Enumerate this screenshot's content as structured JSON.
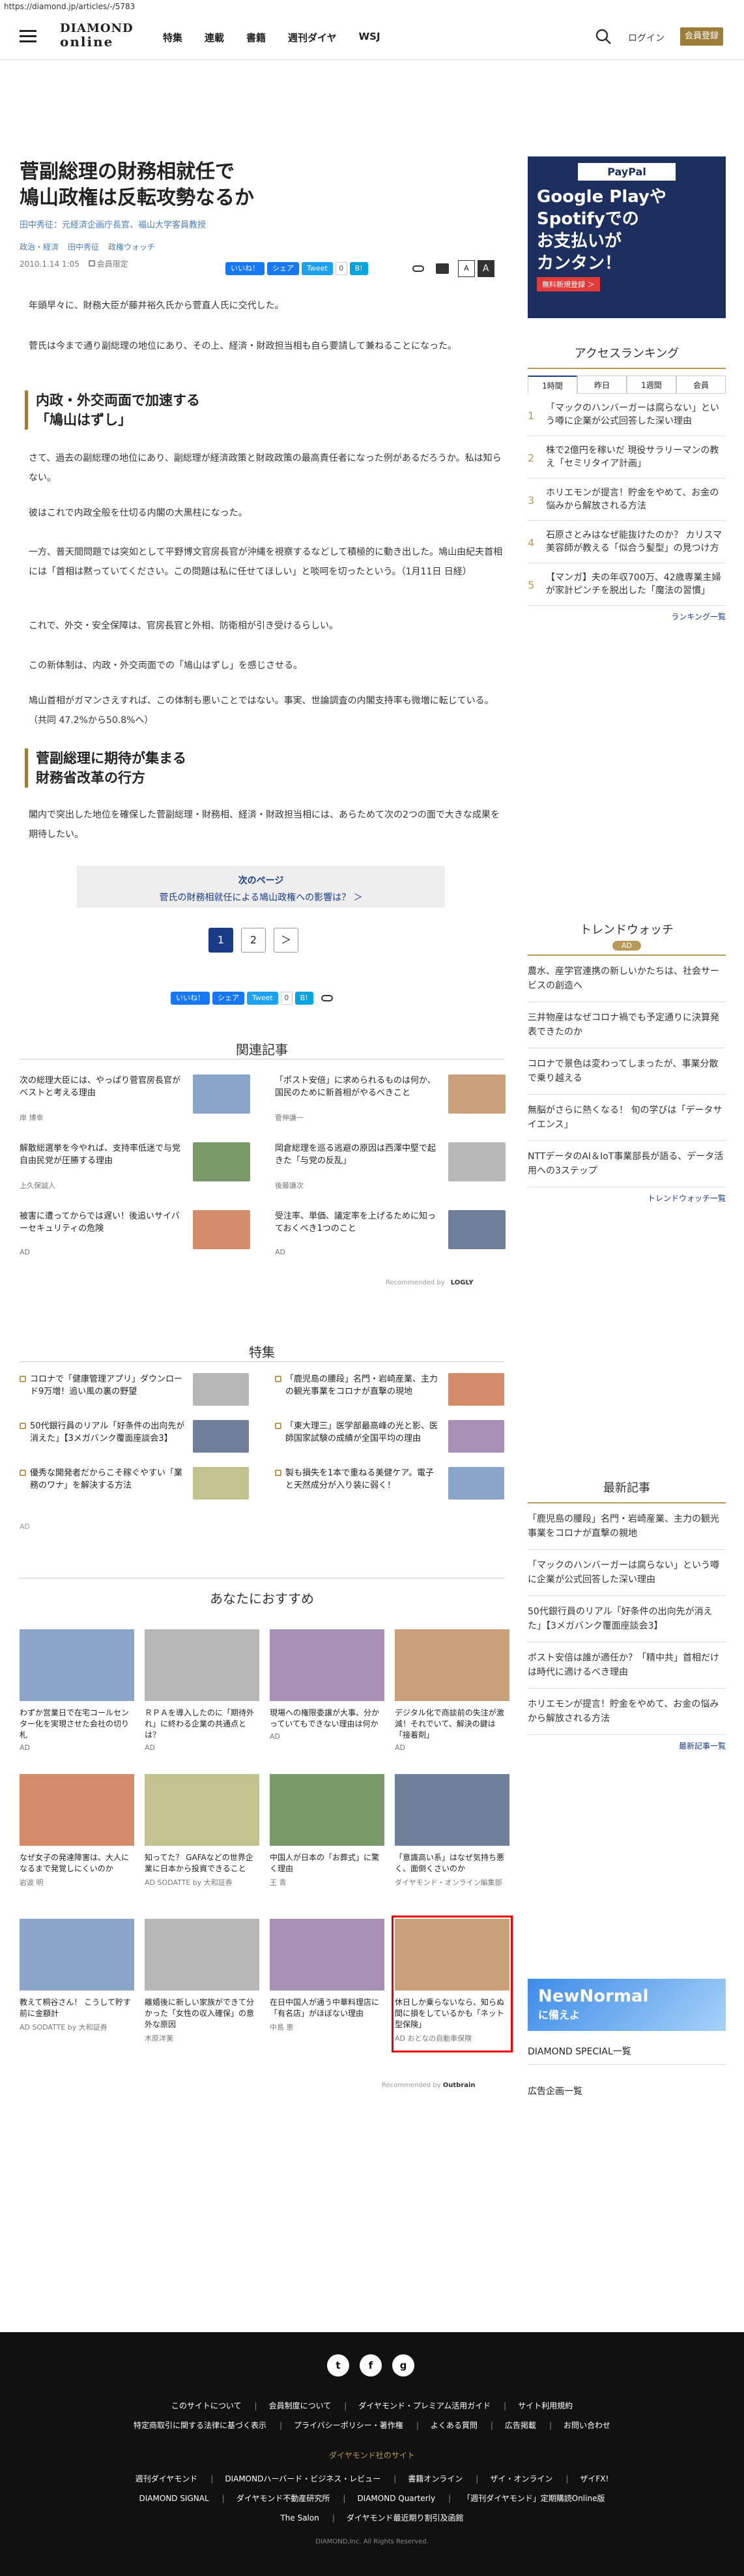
{
  "url": "https://diamond.jp/articles/-/5783",
  "header": {
    "logo_top": "DIAMOND",
    "logo_bottom": "online",
    "nav": [
      "特集",
      "連載",
      "書籍",
      "週刊ダイヤ",
      "WSJ"
    ],
    "login": "ログイン",
    "register": "会員登録"
  },
  "article": {
    "title_line1": "菅副総理の財務相就任で",
    "title_line2": "鳩山政権は反転攻勢なるか",
    "authors": "田中秀征：元経済企画庁長官、福山大学客員教授",
    "categories": [
      "政治・経済",
      "田中秀征",
      "政権ウォッチ"
    ],
    "date": "2010.1.14 1:05",
    "member": "会員限定",
    "share": {
      "like": "いいね！",
      "share": "シェア",
      "tweet": "Tweet",
      "tweet_count": "0",
      "hatena": "B!",
      "hatena_count": "0",
      "font_small": "A",
      "font_large": "A"
    },
    "paragraphs": [
      "年頭早々に、財務大臣が藤井裕久氏から菅直人氏に交代した。",
      "菅氏は今まで通り副総理の地位にあり、その上、経済・財政担当相も自ら要請して兼ねることになった。",
      "さて、過去の副総理の地位にあり、副総理が経済政策と財政政策の最高責任者になった例があるだろうか。私は知らない。",
      "彼はこれで内政全般を仕切る内閣の大黒柱になった。",
      "一方、普天間問題では突如として平野博文官房長官が沖縄を視察するなどして積極的に動き出した。鳩山由紀夫首相には「首相は黙っていてください。この問題は私に任せてほしい」と啖呵を切ったという。（1月11日 日経）",
      "これで、外交・安全保障は、官房長官と外相、防衛相が引き受けるらしい。",
      "この新体制は、内政・外交両面での「鳩山はずし」を感じさせる。",
      "鳩山首相がガマンさえすれば、この体制も悪いことではない。事実、世論調査の内閣支持率も微増に転じている。（共同 47.2%から50.8%へ）",
      "閣内で突出した地位を確保した菅副総理・財務相、経済・財政担当相には、あらためて次の2つの面で大きな成果を期待したい。"
    ],
    "heading1_line1": "内政・外交両面で加速する",
    "heading1_line2": "「鳩山はずし」",
    "heading2_line1": "菅副総理に期待が集まる",
    "heading2_line2": "財務省改革の行方",
    "next": {
      "label": "次のページ",
      "link": "菅氏の財務相就任による鳩山政権への影響は？ ＞"
    },
    "pages": [
      "1",
      "2",
      "＞"
    ]
  },
  "related": {
    "title": "関連記事",
    "recommended": "Recommended by",
    "rec_brand": "LOGLY",
    "items": [
      {
        "text": "次の総理大臣には、やっぱり菅官房長官がベストと考える理由",
        "sub": "岸 博幸"
      },
      {
        "text": "「ポスト安倍」に求められるものは何か、国民のために新首相がやるべきこと",
        "sub": "菅伸謙一"
      },
      {
        "text": "解散総選挙を今やれば、支持率低迷で与党自由民党が圧勝する理由",
        "sub": "上久保誠人"
      },
      {
        "text": "岡倉総理を巡る逃避の原因は西澤中堅で起きた「与党の反乱」",
        "sub": "後藤謙次"
      },
      {
        "text": "被害に遭ってからでは遅い！後追いサイバーセキュリティの危険",
        "sub": "AD"
      },
      {
        "text": "受注率、単価、議定率を上げるために知っておくべき1つのこと",
        "sub": "AD"
      }
    ]
  },
  "special": {
    "title": "特集",
    "items": [
      {
        "text": "コロナで「健康管理アプリ」ダウンロード9万増！追い風の裏の野望"
      },
      {
        "text": "「鹿児島の腰段」名門・岩崎産業、主力の観光事業をコロナが直撃の現地"
      },
      {
        "text": "50代銀行員のリアル「好条件の出向先が消えた」【3メガバンク覆面座談会3】"
      },
      {
        "text": "「東大理三」医学部最高峰の光と影、医師国家試験の成績が全国平均の理由"
      },
      {
        "text": "優秀な開発者だからこそ稼ぐやすい「業務のワナ」を解決する方法"
      },
      {
        "text": "製も損失を1本で重ねる美健ケア。電子と天然成分が入り装に弱く！"
      }
    ],
    "ad": "AD"
  },
  "recommend": {
    "title": "あなたにおすすめ",
    "outbrain": "Recommended by",
    "outbrain_brand": "Outbrain",
    "items": [
      {
        "text": "わずか営業日で在宅コールセンター化を実現させた会社の切り札",
        "sub": "AD"
      },
      {
        "text": "ＲＰＡを導入したのに「期待外れ」に終わる企業の共通点とは？",
        "sub": "AD"
      },
      {
        "text": "現場への権限委譲が大事、分かっていてもできない理由は何か",
        "sub": "AD"
      },
      {
        "text": "デジタル化で商談前の失注が激減！それでいて、解決の鍵は「接着剤」",
        "sub": "AD"
      },
      {
        "text": "なぜ女子の発達障害は、大人になるまで発覚しにくいのか",
        "sub": "岩波 明"
      },
      {
        "text": "知ってた？ GAFAなどの世界企業に日本から投資できること",
        "sub": "AD SODATTE by 大和証券"
      },
      {
        "text": "中国人が日本の「お葬式」に驚く理由",
        "sub": "王 青"
      },
      {
        "text": "「意識高い系」はなぜ気持ち悪く、面倒くさいのか",
        "sub": "ダイヤモンド・オンライン編集部"
      },
      {
        "text": "教えて桐谷さん！ こうして貯す前に金額計",
        "sub": "AD SODATTE by 大和証券"
      },
      {
        "text": "離婚後に新しい家族ができて分かった「女性の収入確保」の意外な原因",
        "sub": "木原洋美"
      },
      {
        "text": "在日中国人が通う中華料理店に「有名店」がほぼない理由",
        "sub": "中島 恵"
      },
      {
        "text": "休日しか乗らないなら、知らぬ間に損をしているかも「ネット型保険」",
        "sub": "AD おとなの自動車保険"
      }
    ]
  },
  "sidebar": {
    "paypay_title": "PayPal",
    "paypay_line1": "Google Playや",
    "paypay_line2": "Spotifyでの",
    "paypay_line3": "お支払いが",
    "paypay_line4": "カンタン！",
    "paypay_cta": "無料新規登録 ＞",
    "ranking_title": "アクセスランキング",
    "tabs": [
      "1時間",
      "昨日",
      "1週間",
      "会員"
    ],
    "ranking": [
      {
        "n": "1",
        "text": "「マックのハンバーガーは腐らない」という噂に企業が公式回答した深い理由"
      },
      {
        "n": "2",
        "text": "株で2億円を稼いだ 現役サラリーマンの教え「セミリタイア計画」"
      },
      {
        "n": "3",
        "text": "ホリエモンが提言！貯金をやめて、お金の悩みから解放される方法"
      },
      {
        "n": "4",
        "text": "石原さとみはなぜ能抜けたのか？ カリスマ美容師が教える「似合う髪型」の見つけ方"
      },
      {
        "n": "5",
        "text": "【マンガ】夫の年収700万、42歳専業主婦が家計ピンチを脱出した「魔法の習慣」"
      }
    ],
    "ranking_more": "ランキング一覧",
    "trend_title": "トレンドウォッチ",
    "trend_ad": "AD",
    "trend": [
      "農水、産学官連携の新しいかたちは、社会サービスの創造へ",
      "三井物産はなぜコロナ禍でも予定通りに決算発表できたのか",
      "コロナで景色は変わってしまったが、事業分散で乗り越える",
      "無脳がさらに熱くなる！ 旬の学びは「データサイエンス」",
      "NTTデータのAI＆IoT事業部長が語る、データ活用への3ステップ"
    ],
    "trend_more": "トレンドウォッチ一覧",
    "latest_title": "最新記事",
    "latest": [
      "「鹿児島の腰段」名門・岩崎産業、主力の観光事業をコロナが直撃の親地",
      "「マックのハンバーガーは腐らない」という噂に企業が公式回答した深い理由",
      "50代銀行員のリアル「好条件の出向先が消えた」【3メガバンク覆面座談会3】",
      "ポスト安倍は誰が適任か？「精中共」首相だけは時代に適けるべき理由",
      "ホリエモンが提言！貯金をやめて、お金の悩みから解放される方法"
    ],
    "latest_more": "最新記事一覧",
    "newnormal_l1": "NewNormal",
    "newnormal_l2": "に備えよ",
    "special_list": "DIAMOND SPECIAL一覧",
    "ad_list": "広告企画一覧"
  },
  "footer": {
    "social": [
      "t",
      "f",
      "g"
    ],
    "row1": [
      "このサイトについて",
      "会員制度について",
      "ダイヤモンド・プレミアム活用ガイド",
      "サイト利用規約"
    ],
    "row2": [
      "特定商取引に関する法律に基づく表示",
      "プライバシーポリシー・著作権",
      "よくある質問",
      "広告掲載",
      "お問い合わせ"
    ],
    "group": "ダイヤモンド社のサイト",
    "row3": [
      "週刊ダイヤモンド",
      "DIAMONDハーバード・ビジネス・レビュー",
      "書籍オンライン",
      "ザイ・オンライン",
      "ザイFX!"
    ],
    "row4": [
      "DIAMOND SIGNAL",
      "ダイヤモンド不動産研究所",
      "DIAMOND Quarterly",
      "「週刊ダイヤモンド」定期購読Online版"
    ],
    "row5": [
      "The Salon",
      "ダイヤモンド最近期り割引及函館"
    ],
    "copyright": "DIAMOND,Inc. All Rights Reserved."
  },
  "colors": {
    "accent": "#9c7d3a",
    "link": "#1a3c86",
    "facebook": "#1877f2",
    "twitter": "#1da1f2",
    "hatena": "#00a4de"
  }
}
